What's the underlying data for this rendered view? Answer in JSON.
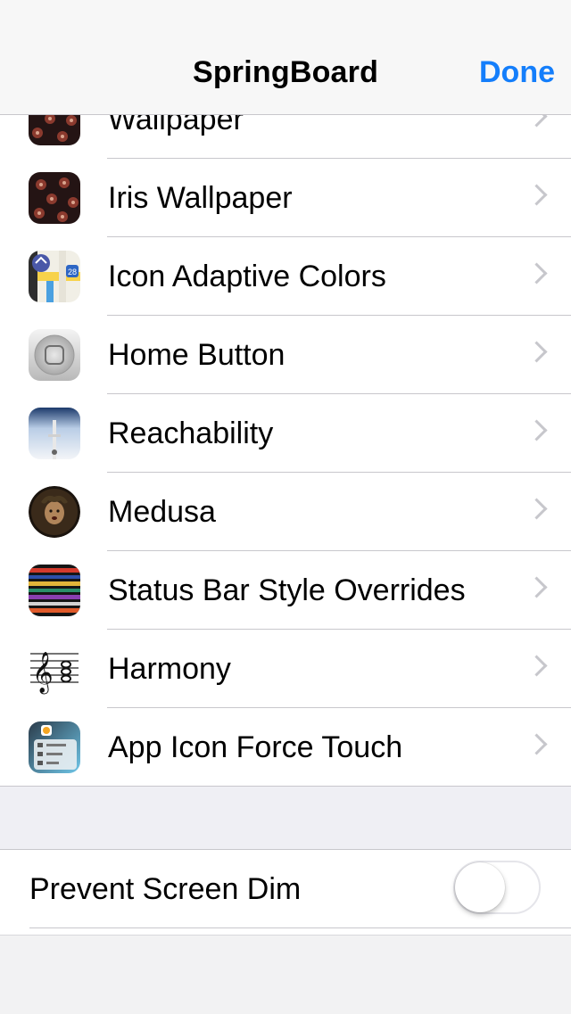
{
  "navbar": {
    "title": "SpringBoard",
    "done_label": "Done"
  },
  "items": [
    {
      "label": "Wallpaper",
      "icon": "wallpaper-icon"
    },
    {
      "label": "Iris Wallpaper",
      "icon": "iris-wallpaper-icon"
    },
    {
      "label": "Icon Adaptive Colors",
      "icon": "maps-icon"
    },
    {
      "label": "Home Button",
      "icon": "home-button-icon"
    },
    {
      "label": "Reachability",
      "icon": "reachability-icon"
    },
    {
      "label": "Medusa",
      "icon": "medusa-icon"
    },
    {
      "label": "Status Bar Style Overrides",
      "icon": "status-bar-icon"
    },
    {
      "label": "Harmony",
      "icon": "music-staff-icon"
    },
    {
      "label": "App Icon Force Touch",
      "icon": "force-touch-icon"
    }
  ],
  "toggle": {
    "label": "Prevent Screen Dim",
    "on": false
  },
  "colors": {
    "accent": "#147efb",
    "separator": "#c8c7cc",
    "group_background": "#efeff4"
  }
}
